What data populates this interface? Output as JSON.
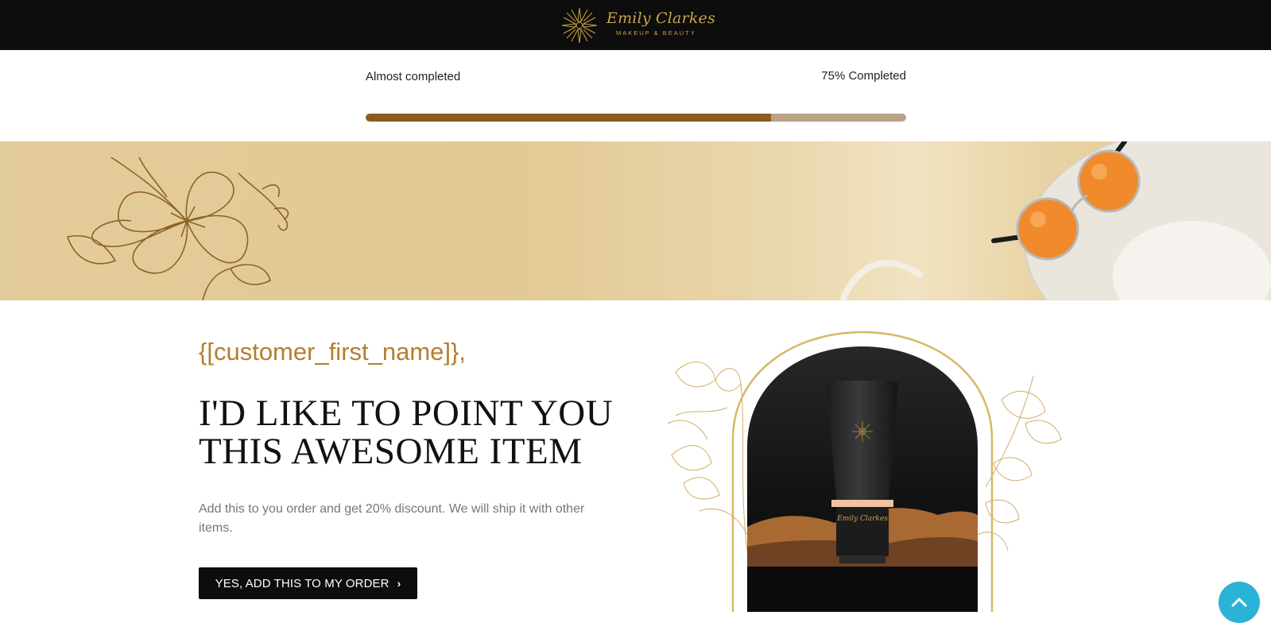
{
  "brand": {
    "name": "Emily Clarkes",
    "tagline": "MAKEUP & BEAUTY",
    "accent_color": "#c8a24c"
  },
  "progress": {
    "status_label": "Almost completed",
    "percent_label": "75% Completed",
    "percent": 75,
    "fill_color": "#8a5c1f",
    "track_color": "#b9a287"
  },
  "offer": {
    "greeting": "{[customer_first_name]},",
    "headline_line1": "I'D LIKE TO POINT YOU",
    "headline_line2": "THIS AWESOME ITEM",
    "description": "Add this to you order and get 20% discount. We will ship it with other items.",
    "cta_label": "YES, ADD THIS TO MY ORDER",
    "cta_icon": "chevron-right-icon"
  },
  "product": {
    "tube_label": "Emily Clarkes"
  },
  "scroll_top_icon": "chevron-up-icon"
}
